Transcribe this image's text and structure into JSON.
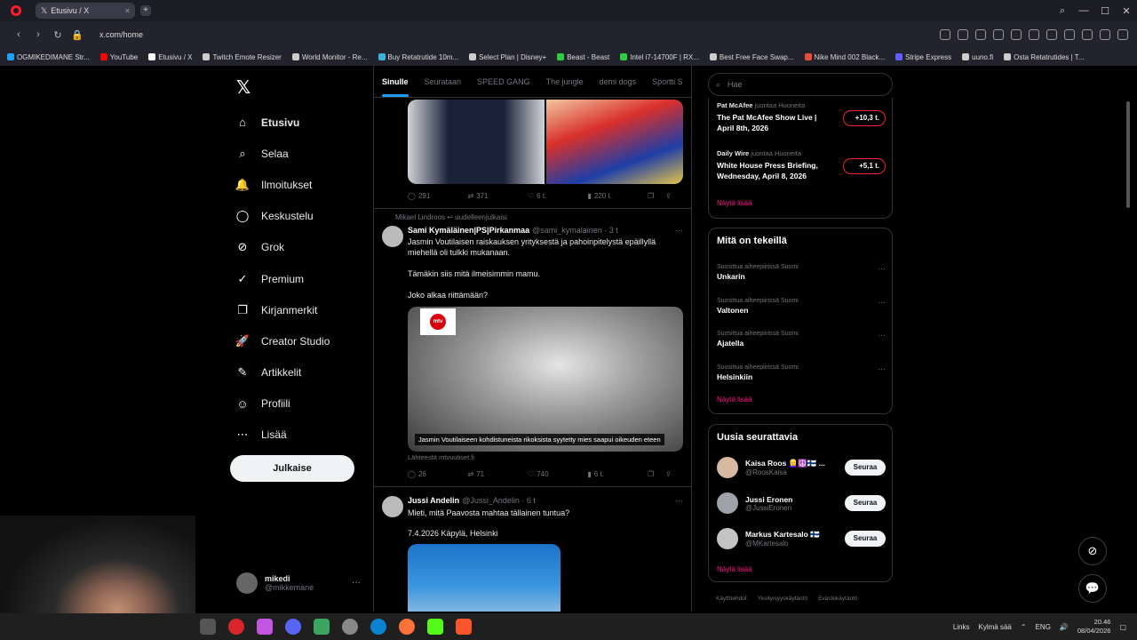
{
  "browser": {
    "tab_title": "Etusivu / X",
    "tab_close": "×",
    "new_tab": "+",
    "window_controls": [
      "⌕",
      "—",
      "☐",
      "✕"
    ],
    "url": "x.com/home",
    "bookmarks": [
      {
        "label": "OGMIKEDIMANE Str...",
        "color": "#1da1f2"
      },
      {
        "label": "YouTube",
        "color": "#ff0000"
      },
      {
        "label": "Etusivu / X",
        "color": "#ffffff"
      },
      {
        "label": "Twitch Emote Resizer",
        "color": "#cccccc"
      },
      {
        "label": "World Monitor - Re...",
        "color": "#cccccc"
      },
      {
        "label": "Buy Retatrutide 10m...",
        "color": "#3bb3e0"
      },
      {
        "label": "Select Plan | Disney+",
        "color": "#cccccc"
      },
      {
        "label": "Beast - Beast",
        "color": "#2ecc40"
      },
      {
        "label": "Intel i7-14700F | RX...",
        "color": "#2ecc40"
      },
      {
        "label": "Best Free Face Swap...",
        "color": "#cccccc"
      },
      {
        "label": "Nike Mind 002 Black...",
        "color": "#e74c3c"
      },
      {
        "label": "Stripe Express",
        "color": "#635bff"
      },
      {
        "label": "uuno.fi",
        "color": "#cccccc"
      },
      {
        "label": "Osta Retatrutides | T...",
        "color": "#cccccc"
      }
    ]
  },
  "sidebar": {
    "logo": "𝕏",
    "items": [
      {
        "label": "Etusivu",
        "icon": "⌂"
      },
      {
        "label": "Selaa",
        "icon": "⌕"
      },
      {
        "label": "Ilmoitukset",
        "icon": "🔔"
      },
      {
        "label": "Keskustelu",
        "icon": "◯"
      },
      {
        "label": "Grok",
        "icon": "⊘"
      },
      {
        "label": "Premium",
        "icon": "✓"
      },
      {
        "label": "Kirjanmerkit",
        "icon": "❐"
      },
      {
        "label": "Creator Studio",
        "icon": "🚀"
      },
      {
        "label": "Artikkelit",
        "icon": "✎"
      },
      {
        "label": "Profiili",
        "icon": "☺"
      },
      {
        "label": "Lisää",
        "icon": "⋯"
      }
    ],
    "post_button": "Julkaise",
    "account_name": "mikedi",
    "account_handle": "@mikkemane",
    "account_more": "···"
  },
  "feed": {
    "tabs": [
      "Sinulle",
      "Seurataan",
      "SPEED GANG",
      "The jungle",
      "demi dogs",
      "Sportti S"
    ],
    "post1_stats": {
      "replies": "291",
      "reposts": "371",
      "likes": "6 t.",
      "views": "220 t."
    },
    "repost_note": "Mikael Lindroos ↩ uudelleenjulkaisi",
    "tweet2": {
      "name": "Sami Kymäläinen|PS|Pirkanmaa",
      "handle": "@sami_kymalainen · 3 t",
      "more": "···",
      "lines": [
        "Jasmin Voutilaisen raiskauksen yrityksestä ja pahoinpitelystä epäillyllä miehellä oli tulkki mukanaan.",
        "Tämäkin siis mitä ilmeisimmin mamu.",
        "Joko alkaa riittämään?"
      ],
      "logo_text": "mtv",
      "caption": "Jasmin Voutilaiseen kohdistuneista rikoksista syytetty mies saapui oikeuden eteen",
      "source": "Lähteestä mtvuutiset.fi",
      "stats": {
        "replies": "26",
        "reposts": "71",
        "likes": "740",
        "views": "6 t."
      }
    },
    "tweet3": {
      "name": "Jussi Andelin",
      "handle": "@Jussi_Andelin · 6 t",
      "more": "···",
      "line1": "Mieti, mitä Paavosta mahtaa tällainen tuntua?",
      "line2": "7.4.2026 Käpylä, Helsinki"
    }
  },
  "right": {
    "search_placeholder": "Hae",
    "live": [
      {
        "host": "Pat McAfee",
        "status": "juontaa Huoneita",
        "title": "The Pat McAfee Show Live | April 8th, 2026",
        "badge": "+10,3 t."
      },
      {
        "host": "Daily Wire",
        "status": "juontaa Huoneita",
        "title": "White House Press Briefing, Wednesday, April 8, 2026",
        "badge": "+5,1 t."
      }
    ],
    "live_show_more": "Näytä lisää",
    "trends_title": "Mitä on tekeillä",
    "trends": [
      {
        "sub": "Suosittua aiheepiirissä Suomi",
        "name": "Unkarin"
      },
      {
        "sub": "Suosittua aiheepiirissä Suomi",
        "name": "Valtonen"
      },
      {
        "sub": "Suosittua aiheepiirissä Suomi",
        "name": "Ajatella"
      },
      {
        "sub": "Suosittua aiheepiirissä Suomi",
        "name": "Helsinkiin"
      }
    ],
    "trend_more": "···",
    "trends_show_more": "Näytä lisää",
    "follow_title": "Uusia seurattavia",
    "follow": [
      {
        "name": "Kaisa Roos 👱‍♀️☮️🇫🇮 ...",
        "handle": "@RoosKaisa",
        "button": "Seuraa",
        "color": "#d7b8a0"
      },
      {
        "name": "Jussi Eronen",
        "handle": "@JussiEronen",
        "button": "Seuraa",
        "color": "#9da3a8"
      },
      {
        "name": "Markus Kartesalo 🇫🇮",
        "handle": "@MKartesalo",
        "button": "Seuraa",
        "color": "#c4c4c4"
      }
    ],
    "follow_show_more": "Näytä lisää",
    "footer": [
      "Käyttöehdot",
      "Yksityisyyskäytäntö",
      "Evästekäytäntö"
    ]
  },
  "floating": {
    "grok": "⊘",
    "messages": "💬"
  },
  "taskbar": {
    "links": "Links",
    "weather": "Kylmä sää",
    "lang": "ENG",
    "time": "20.46",
    "date": "08/04/2026"
  }
}
